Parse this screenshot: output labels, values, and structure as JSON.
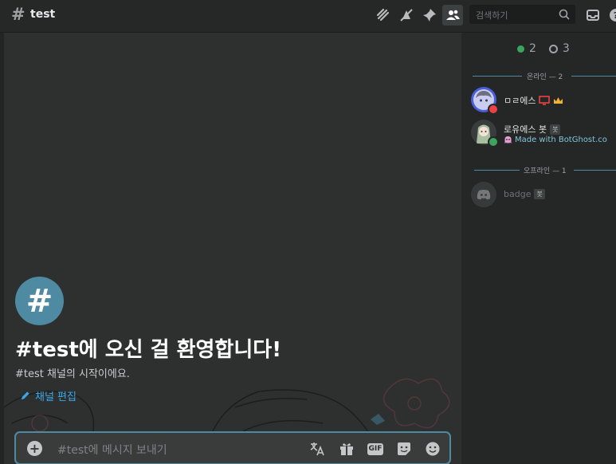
{
  "header": {
    "channel_name": "test",
    "search_placeholder": "검색하기"
  },
  "welcome": {
    "title": "#test에 오신 걸 환영합니다!",
    "subtitle": "#test 채널의 시작이에요.",
    "edit_label": "채널 편집"
  },
  "composer": {
    "placeholder": "#test에 메시지 보내기",
    "gif_label": "GIF"
  },
  "sidebar": {
    "online_count": "2",
    "offline_count": "3",
    "online_section": "온라인 — 2",
    "offline_section": "오프라인 — 1",
    "members": [
      {
        "name": "ㅁㄹ에스",
        "status": ""
      },
      {
        "name": "로유에스 봇",
        "tag": "봇",
        "status": "Made with BotGhost.co"
      }
    ],
    "offline_members": [
      {
        "name": "badge",
        "tag": "봇"
      }
    ]
  },
  "colors": {
    "accent": "#4f8aa3",
    "online": "#3ba55d",
    "link": "#3aa8e8"
  }
}
